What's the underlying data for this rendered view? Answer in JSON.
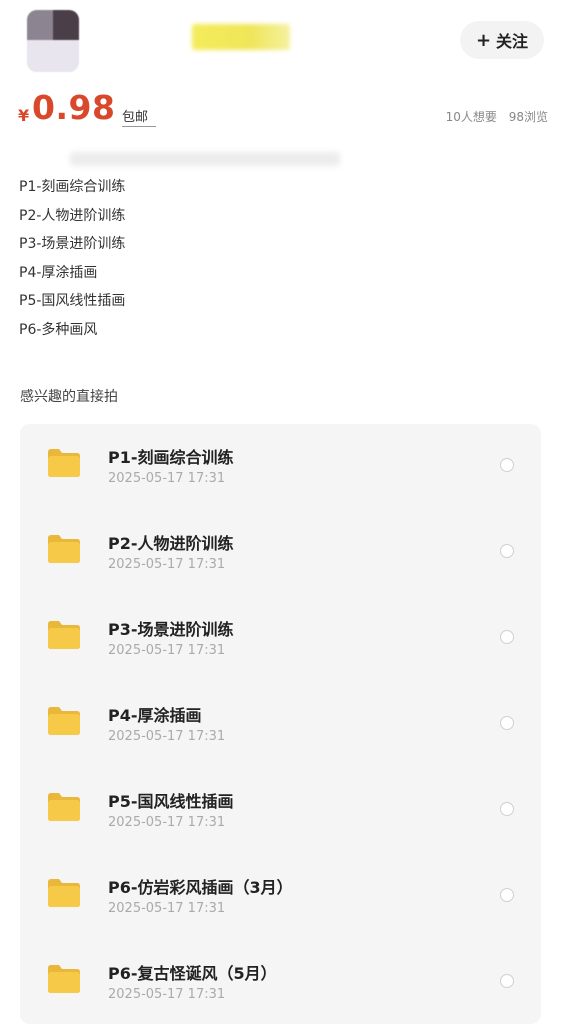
{
  "header": {
    "follow_label": "关注",
    "follow_plus": "+"
  },
  "price": {
    "symbol": "¥",
    "value": "0.98",
    "shipping": "包邮",
    "wants": "10人想要",
    "views": "98浏览"
  },
  "description": {
    "items": [
      "P1-刻画综合训练",
      "P2-人物进阶训练",
      "P3-场景进阶训练",
      "P4-厚涂插画",
      "P5-国风线性插画",
      "P6-多种画风"
    ],
    "interest_text": "感兴趣的直接拍"
  },
  "files": {
    "items": [
      {
        "name": "P1-刻画综合训练",
        "date": "2025-05-17  17:31"
      },
      {
        "name": "P2-人物进阶训练",
        "date": "2025-05-17  17:31"
      },
      {
        "name": "P3-场景进阶训练",
        "date": "2025-05-17  17:31"
      },
      {
        "name": "P4-厚涂插画",
        "date": "2025-05-17  17:31"
      },
      {
        "name": "P5-国风线性插画",
        "date": "2025-05-17  17:31"
      },
      {
        "name": "P6-仿岩彩风插画（3月）",
        "date": "2025-05-17  17:31"
      },
      {
        "name": "P6-复古怪诞风（5月）",
        "date": "2025-05-17  17:31"
      }
    ]
  },
  "colors": {
    "price": "#d9482b",
    "folder": "#f7c948",
    "list_bg": "#f5f5f5"
  },
  "icons": {
    "folder": "folder-icon",
    "radio": "radio-icon",
    "plus": "plus-icon"
  }
}
